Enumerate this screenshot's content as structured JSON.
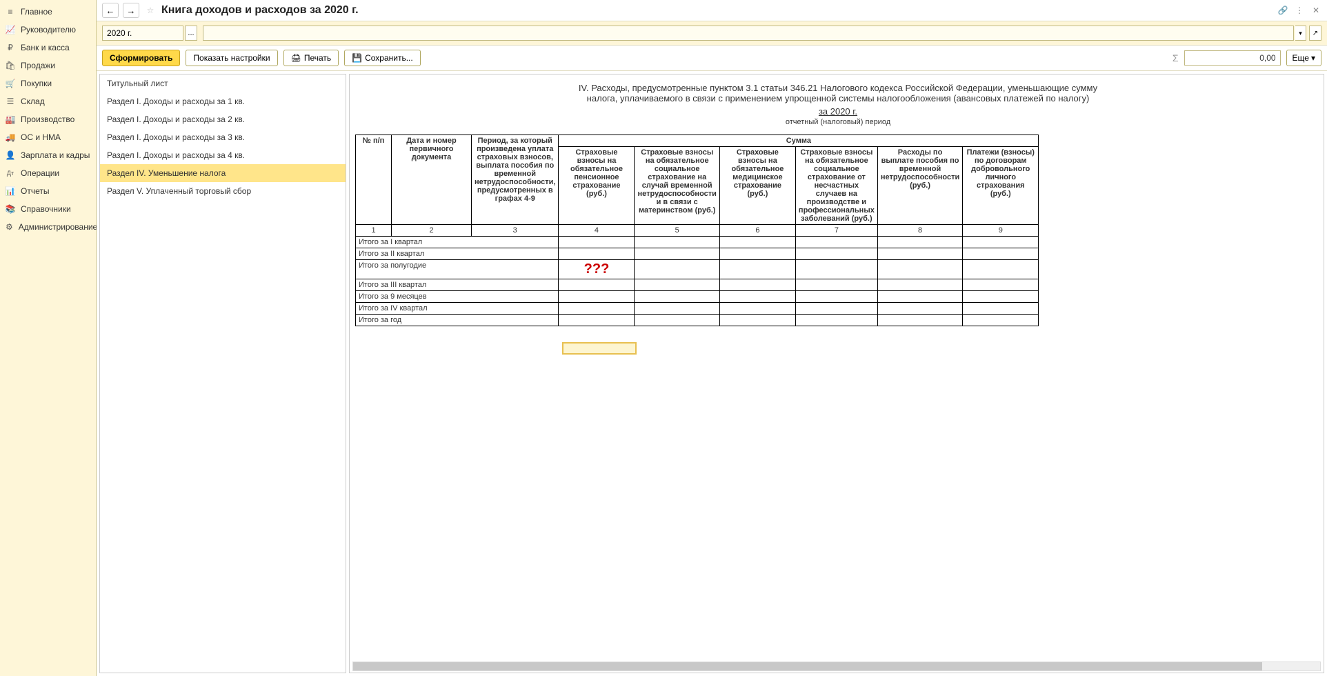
{
  "sidebar": {
    "items": [
      {
        "icon": "≡",
        "label": "Главное"
      },
      {
        "icon": "📈",
        "label": "Руководителю"
      },
      {
        "icon": "₽",
        "label": "Банк и касса"
      },
      {
        "icon": "🛍",
        "label": "Продажи"
      },
      {
        "icon": "🛒",
        "label": "Покупки"
      },
      {
        "icon": "☰",
        "label": "Склад"
      },
      {
        "icon": "🏭",
        "label": "Производство"
      },
      {
        "icon": "🚚",
        "label": "ОС и НМА"
      },
      {
        "icon": "👤",
        "label": "Зарплата и кадры"
      },
      {
        "icon": "Дт",
        "label": "Операции"
      },
      {
        "icon": "📊",
        "label": "Отчеты"
      },
      {
        "icon": "📚",
        "label": "Справочники"
      },
      {
        "icon": "⚙",
        "label": "Администрирование"
      }
    ]
  },
  "header": {
    "title": "Книга доходов и расходов за 2020 г."
  },
  "period": {
    "value": "2020 г.",
    "picker_label": "..."
  },
  "toolbar": {
    "form": "Сформировать",
    "settings": "Показать настройки",
    "print": "Печать",
    "save": "Сохранить...",
    "more": "Еще",
    "sum_symbol": "Σ",
    "sum_value": "0,00"
  },
  "sections": [
    "Титульный лист",
    "Раздел I. Доходы и расходы за 1 кв.",
    "Раздел I. Доходы и расходы за 2 кв.",
    "Раздел I. Доходы и расходы за 3 кв.",
    "Раздел I. Доходы и расходы за 4 кв.",
    "Раздел IV. Уменьшение налога",
    "Раздел V. Уплаченный торговый сбор"
  ],
  "report": {
    "title_line1": "IV. Расходы, предусмотренные пунктом 3.1 статьи 346.21 Налогового кодекса Российской Федерации, уменьшающие сумму",
    "title_line2": "налога, уплачиваемого в связи с применением упрощенной системы налогообложения (авансовых платежей по налогу)",
    "period": "за 2020 г.",
    "sub": "отчетный (налоговый) период",
    "cols": {
      "num": "№ п/п",
      "doc": "Дата и номер первичного документа",
      "period": "Период, за который произведена уплата страховых взносов, выплата пособия по временной нетрудоспособности, предусмотренных в графах 4-9",
      "sum": "Сумма",
      "c4": "Страховые взносы на обязательное пенсионное страхование (руб.)",
      "c5": "Страховые взносы на обязательное социальное страхование на случай временной нетрудоспособности и в связи с материнством (руб.)",
      "c6": "Страховые взносы на обязательное медицинское страхование (руб.)",
      "c7": "Страховые взносы на обязательное социальное страхование от несчастных случаев на производстве и профессиональных заболеваний (руб.)",
      "c8": "Расходы по выплате пособия по временной нетрудоспособности (руб.)",
      "c9": "Платежи (взносы) по договорам добровольного личного страхования (руб.)"
    },
    "col_nums": [
      "1",
      "2",
      "3",
      "4",
      "5",
      "6",
      "7",
      "8",
      "9"
    ],
    "rows": [
      "Итого за I квартал",
      "Итого за II квартал",
      "Итого за полугодие",
      "Итого за III квартал",
      "Итого за 9 месяцев",
      "Итого за IV квартал",
      "Итого за год"
    ],
    "annotation": "???"
  }
}
